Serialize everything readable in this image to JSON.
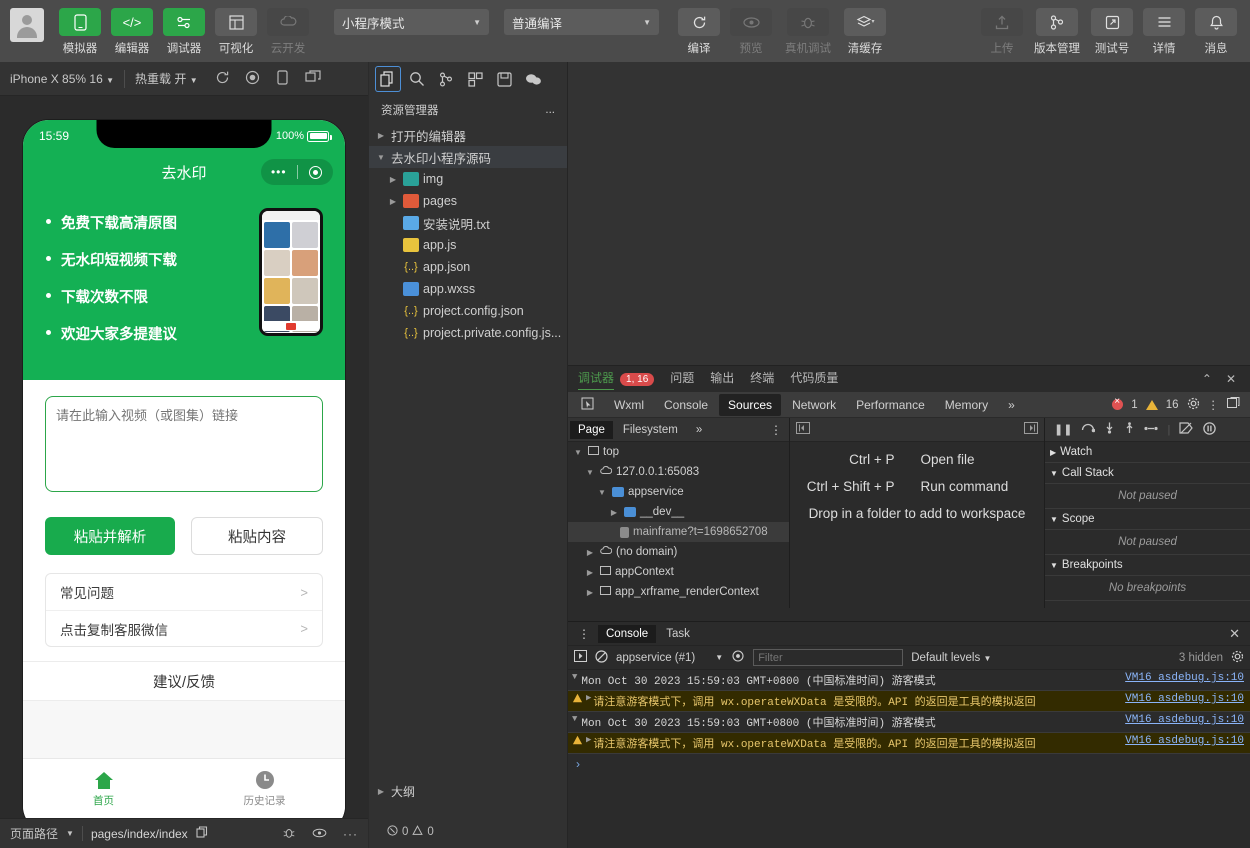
{
  "toolbar": {
    "left_tools": [
      {
        "label": "模拟器",
        "icon": "phone-icon",
        "style": "green"
      },
      {
        "label": "编辑器",
        "icon": "code-icon",
        "style": "green"
      },
      {
        "label": "调试器",
        "icon": "debug-icon",
        "style": "green"
      },
      {
        "label": "可视化",
        "icon": "layout-icon",
        "style": "grey"
      },
      {
        "label": "云开发",
        "icon": "cloud-icon",
        "style": "dim"
      }
    ],
    "mode_select": "小程序模式",
    "compile_select": "普通编译",
    "mid_tools": [
      {
        "label": "编译",
        "icon": "refresh-icon",
        "style": "grey"
      },
      {
        "label": "预览",
        "icon": "eye-icon",
        "style": "dim"
      },
      {
        "label": "真机调试",
        "icon": "bug-icon",
        "style": "dim"
      },
      {
        "label": "清缓存",
        "icon": "layers-icon",
        "style": "grey"
      }
    ],
    "right_tools": [
      {
        "label": "上传",
        "icon": "upload-icon",
        "style": "dim"
      },
      {
        "label": "版本管理",
        "icon": "branch-icon",
        "style": "grey"
      },
      {
        "label": "测试号",
        "icon": "external-icon",
        "style": "grey"
      },
      {
        "label": "详情",
        "icon": "menu-icon",
        "style": "grey"
      },
      {
        "label": "消息",
        "icon": "bell-icon",
        "style": "grey"
      }
    ]
  },
  "simulator": {
    "device": "iPhone X 85% 16",
    "hotreload": "热重载 开",
    "icons": [
      "rotate-icon",
      "record-icon",
      "device-icon",
      "multiscreen-icon"
    ],
    "phone": {
      "time": "15:59",
      "battery": "100%",
      "nav_title": "去水印",
      "features": [
        "免费下载高清原图",
        "无水印短视频下载",
        "下载次数不限",
        "欢迎大家多提建议"
      ],
      "input_placeholder": "请在此输入视频（或图集）链接",
      "btn_primary": "粘贴并解析",
      "btn_ghost": "粘贴内容",
      "list_rows": [
        "常见问题",
        "点击复制客服微信"
      ],
      "chevron": ">",
      "feedback": "建议/反馈",
      "tabs": [
        {
          "label": "首页",
          "icon": "home-icon",
          "active": true
        },
        {
          "label": "历史记录",
          "icon": "clock-icon",
          "active": false
        }
      ]
    },
    "pathbar": {
      "label": "页面路径",
      "value": "pages/index/index",
      "icons": [
        "copy-icon",
        "bug-icon",
        "eye-icon",
        "more-icon"
      ]
    }
  },
  "explorer": {
    "activity_icons": [
      "files-icon",
      "search-icon",
      "source-control-icon",
      "extensions-icon",
      "save-icon",
      "miniprogram-icon"
    ],
    "title": "资源管理器",
    "more": "...",
    "sections": [
      {
        "label": "打开的编辑器",
        "expanded": false
      },
      {
        "label": "去水印小程序源码",
        "expanded": true
      }
    ],
    "files": [
      {
        "name": "img",
        "type": "folder-img",
        "indent": 2,
        "arrow": "▸",
        "color": "#2aa198"
      },
      {
        "name": "pages",
        "type": "folder-pages",
        "indent": 2,
        "arrow": "▸",
        "color": "#e05a3a"
      },
      {
        "name": "安装说明.txt",
        "type": "txt",
        "indent": 3,
        "arrow": "",
        "color": "#5aa9e6"
      },
      {
        "name": "app.js",
        "type": "js",
        "indent": 3,
        "arrow": "",
        "color": "#e8c33d"
      },
      {
        "name": "app.json",
        "type": "json",
        "indent": 3,
        "arrow": "",
        "color": "#e8c33d"
      },
      {
        "name": "app.wxss",
        "type": "wxss",
        "indent": 3,
        "arrow": "",
        "color": "#4a90d9"
      },
      {
        "name": "project.config.json",
        "type": "json",
        "indent": 3,
        "arrow": "",
        "color": "#e8c33d"
      },
      {
        "name": "project.private.config.js...",
        "type": "json",
        "indent": 3,
        "arrow": "",
        "color": "#e8c33d"
      }
    ],
    "outline": "大纲",
    "problems": {
      "errors": "0",
      "warnings": "0"
    }
  },
  "devtools": {
    "panel_tabs": [
      {
        "label": "调试器",
        "active": true,
        "badge": "1, 16"
      },
      {
        "label": "问题",
        "active": false
      },
      {
        "label": "输出",
        "active": false
      },
      {
        "label": "终端",
        "active": false
      },
      {
        "label": "代码质量",
        "active": false
      }
    ],
    "panel_actions": [
      "collapse-icon",
      "close-icon"
    ],
    "dt_tabs": [
      {
        "label": "Wxml",
        "active": false
      },
      {
        "label": "Console",
        "active": false
      },
      {
        "label": "Sources",
        "active": true
      },
      {
        "label": "Network",
        "active": false
      },
      {
        "label": "Performance",
        "active": false
      },
      {
        "label": "Memory",
        "active": false
      },
      {
        "label": "»",
        "active": false
      }
    ],
    "error_count": "1",
    "warn_count": "16",
    "right_icons": [
      "gear-icon",
      "kebab-icon",
      "dock-icon"
    ],
    "sources": {
      "nav_tabs": [
        {
          "label": "Page",
          "active": true
        },
        {
          "label": "Filesystem",
          "active": false
        },
        {
          "label": "»",
          "active": false
        }
      ],
      "nav_more": "kebab-icon",
      "tree": [
        {
          "label": "top",
          "indent": 0,
          "arrow": "▾",
          "icon": "frame-icon"
        },
        {
          "label": "127.0.0.1:65083",
          "indent": 1,
          "arrow": "▾",
          "icon": "cloud-icon"
        },
        {
          "label": "appservice",
          "indent": 2,
          "arrow": "▾",
          "icon": "folder-icon"
        },
        {
          "label": "__dev__",
          "indent": 3,
          "arrow": "▸",
          "icon": "folder-icon"
        },
        {
          "label": "mainframe?t=1698652708",
          "indent": 4,
          "arrow": "",
          "icon": "file-icon",
          "selected": true
        },
        {
          "label": "(no domain)",
          "indent": 1,
          "arrow": "▸",
          "icon": "cloud-icon"
        },
        {
          "label": "appContext",
          "indent": 1,
          "arrow": "▸",
          "icon": "frame-icon"
        },
        {
          "label": "app_xrframe_renderContext",
          "indent": 1,
          "arrow": "▸",
          "icon": "frame-icon"
        }
      ],
      "hints": [
        {
          "key": "Ctrl + P",
          "value": "Open file"
        },
        {
          "key": "Ctrl + Shift + P",
          "value": "Run command"
        }
      ],
      "drop_hint": "Drop in a folder to add to workspace",
      "debug_sections": [
        {
          "label": "Watch",
          "arrow": "▸",
          "value": null
        },
        {
          "label": "Call Stack",
          "arrow": "▾",
          "value": "Not paused"
        },
        {
          "label": "Scope",
          "arrow": "▾",
          "value": "Not paused"
        },
        {
          "label": "Breakpoints",
          "arrow": "▾",
          "value": "No breakpoints"
        }
      ],
      "debug_tools": [
        "pause-icon",
        "step-over-icon",
        "step-into-icon",
        "step-out-icon",
        "step-icon",
        "deactivate-breakpoints-icon",
        "pause-exceptions-icon"
      ]
    },
    "console": {
      "tabs": [
        {
          "label": "Console",
          "active": true
        },
        {
          "label": "Task",
          "active": false
        }
      ],
      "kebab": "kebab-icon",
      "close": "close-icon",
      "toolbar": {
        "execute_icon": "execute-icon",
        "clear_icon": "clear-icon",
        "context": "appservice (#1)",
        "eye_icon": "eye-icon",
        "filter_placeholder": "Filter",
        "levels": "Default levels",
        "hidden": "3 hidden",
        "settings_icon": "gear-icon"
      },
      "messages": [
        {
          "type": "group",
          "text": "Mon Oct 30 2023 15:59:03 GMT+0800 (中国标准时间) 游客模式",
          "source": "VM16 asdebug.js:10"
        },
        {
          "type": "warning",
          "text": "请注意游客模式下，调用 wx.operateWXData 是受限的。API 的返回是工具的模拟返回",
          "source": "VM16 asdebug.js:10"
        },
        {
          "type": "group",
          "text": "Mon Oct 30 2023 15:59:03 GMT+0800 (中国标准时间) 游客模式",
          "source": "VM16 asdebug.js:10"
        },
        {
          "type": "warning",
          "text": "请注意游客模式下，调用 wx.operateWXData 是受限的。API 的返回是工具的模拟返回",
          "source": "VM16 asdebug.js:10"
        }
      ],
      "prompt": "›"
    }
  }
}
